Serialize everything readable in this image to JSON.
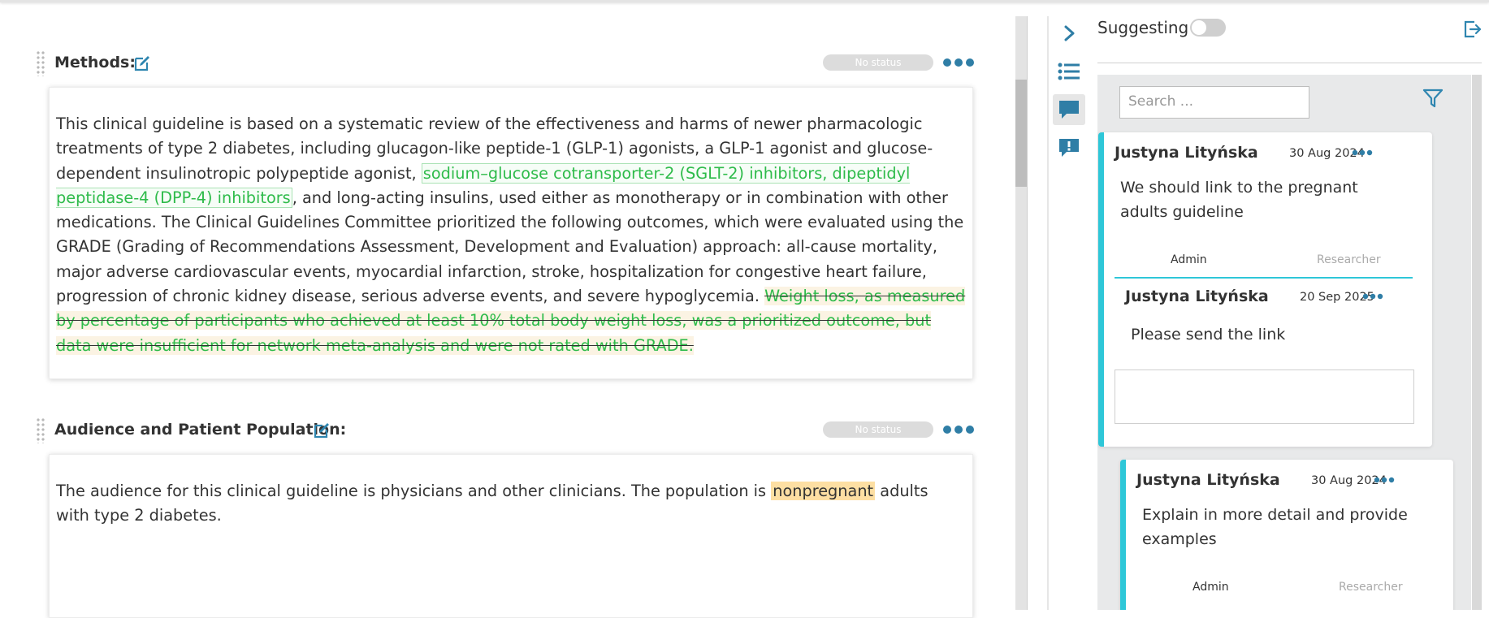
{
  "sections": [
    {
      "title": "Methods:",
      "status": "No status",
      "body": {
        "p1": "This clinical guideline is based on a systematic review of the effectiveness and harms of newer pharmacologic treatments of type 2 diabetes, including glucagon-like peptide-1 (GLP-1) agonists, a GLP-1 agonist and glucose-dependent insulinotropic polypeptide agonist,",
        "inserted": "sodium–glucose cotransporter-2 (SGLT-2) inhibitors, dipeptidyl peptidase-4 (DPP-4) inhibitors",
        "p2": ", and long-acting insulins, used either as monotherapy or in combination with other medications. The Clinical Guidelines Committee prioritized the following outcomes, which were evaluated using the GRADE (Grading of Recommendations Assessment, Development and Evaluation) approach: all-cause mortality, major adverse cardiovascular events, myocardial infarction, stroke, hospitalization for congestive heart failure, progression of chronic kidney disease, serious adverse events, and severe hypoglycemia.",
        "deleted": "Weight loss, as measured by percentage of participants who achieved at least 10% total body weight loss, was a prioritized outcome, but data were insufficient for network meta-analysis and were not rated with GRADE."
      }
    },
    {
      "title": "Audience and Patient Population:",
      "status": "No status",
      "body": {
        "p1": "The audience for this clinical guideline is physicians and other clinicians. The population is",
        "highlighted": "nonpregnant",
        "p2": "adults with type 2 diabetes."
      }
    }
  ],
  "sidebar": {
    "suggesting_label": "Suggesting",
    "suggesting_on": false,
    "icons": [
      "chevron-right-icon",
      "list-icon",
      "comment-icon",
      "alert-icon"
    ],
    "search_placeholder": "Search ...",
    "accent_color": "#2ec7d8",
    "comments": [
      {
        "author": "Justyna Lityńska",
        "date": "30 Aug 2024",
        "text": "We should link to the pregnant adults guideline",
        "roles": [
          "Admin",
          "Researcher"
        ],
        "reply": {
          "author": "Justyna Lityńska",
          "date": "20 Sep 2025",
          "text": "Please send the link"
        }
      },
      {
        "author": "Justyna Lityńska",
        "date": "30 Aug 2024",
        "text": "Explain in more detail and provide examples",
        "roles": [
          "Admin",
          "Researcher"
        ]
      }
    ]
  }
}
